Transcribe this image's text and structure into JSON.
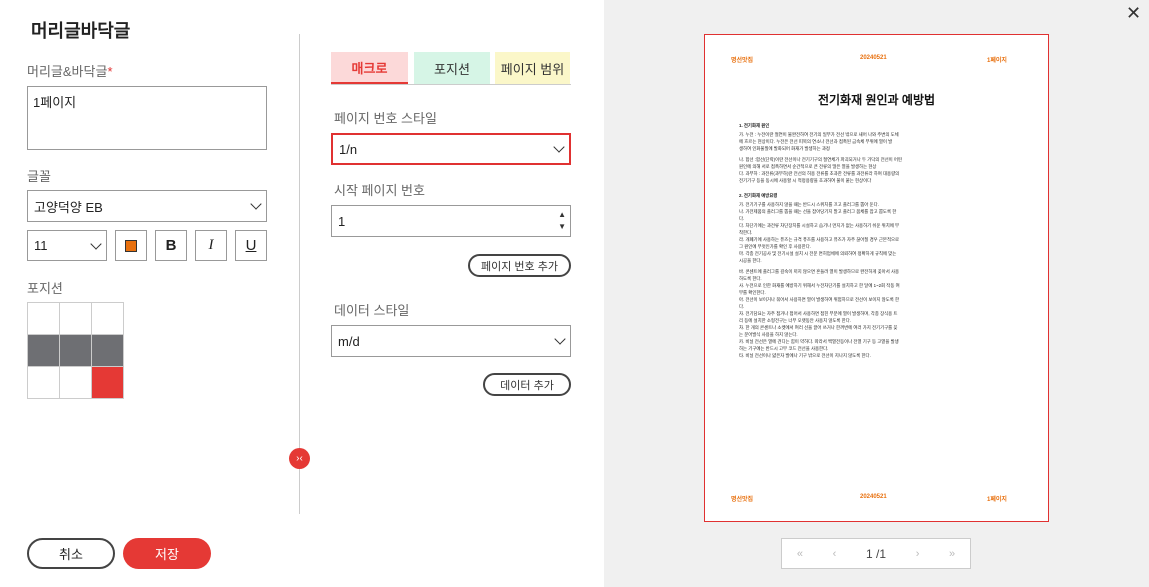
{
  "dialog": {
    "title": "머리글바닥글"
  },
  "left": {
    "header_footer_label": "머리글&바닥글",
    "required_mark": "*",
    "header_footer_value": "1페이지",
    "font_label": "글꼴",
    "font_value": "고양덕양 EB",
    "size_value": "11",
    "text_color": "#e8700e",
    "bold_label": "B",
    "italic_label": "I",
    "underline_label": "U",
    "position_label": "포지션",
    "position_grid": [
      "empty",
      "empty",
      "empty",
      "gray",
      "gray",
      "gray",
      "empty",
      "empty",
      "red"
    ]
  },
  "tabs": [
    {
      "label": "매크로",
      "active": true
    },
    {
      "label": "포지션",
      "active": false
    },
    {
      "label": "페이지 범위",
      "active": false
    }
  ],
  "macro": {
    "page_num_style_label": "페이지 번호 스타일",
    "page_num_style_value": "1/n",
    "start_page_label": "시작 페이지 번호",
    "start_page_value": "1",
    "add_page_num_button": "페이지 번호 추가",
    "data_style_label": "데이터 스타일",
    "data_style_value": "m/d",
    "add_data_button": "데이터 추가"
  },
  "footer": {
    "cancel": "취소",
    "save": "저장"
  },
  "toggle_icon": "›‹",
  "preview": {
    "header_left": "명선맛집",
    "header_center": "20240521",
    "header_right": "1페이지",
    "footer_left": "명선맛집",
    "footer_center": "20240521",
    "footer_right": "1페이지",
    "doc_title": "전기화재 원인과 예방법",
    "section1": "1. 전기화재 원인",
    "s1_lines": [
      "가. 누전 : 누전이란 절연이 불완전하여 전기의 일부가 전선 밖으로 새어 나와 주변의 도체",
      "에 흐르는 현상이다. 누전은 전선 피복의 연소나 전선과 접촉된 금속체 부위에 열이 발",
      "생하여 인화물질에 발화되어 화재가 발생하는 과정"
    ],
    "s1_lines_b": [
      "나. 합선 :합선(단락)이란 전선이나 전기기구의 절연체가 파괴되거나 두 가닥의 전선이 어떤",
      "원인에 의해 서로 접촉하면서 순간적으로 큰 전류의 많은 열을 발생하는 현상",
      "다. 과부하 : 과전류(과부하)란 전선의 허용 전류를 초과한 전류를 과전류라 하며 대용량의",
      "전기기구 등을 동시에 사용할 시 적정용량을 초과하여 불이 붙는 현상이다"
    ],
    "section2": "2. 전기화재 예방요령",
    "s2_lines": [
      "가. 전기기구를 사용하지 않을 때는 반드시 스위치를 끄고 플러그를 뽑아 둔다.",
      "나. 가전제품의 플러그를 뽑을 때는 선을 잡아당기지 말고 플러그 몸체를 잡고 뽑도록 한",
      "다.",
      "다. 차단기에는 과전류 차단장치를 시설하고 습기나 먼지가 없는 사용하기 쉬운 위치에 부",
      "착한다.",
      "라. 개폐기에 사용하는 퓨즈는 규격 퓨즈를 사용하고 퓨즈가 자주 끊어질 경우 근본적으로",
      "그 원인에 무엇인가를 확인 후 사용한다.",
      "마. 각종 전기공사 및 전기시설 설치 시 전문 면허업체에 의뢰하여 정확하게 규칙에 맞는",
      "시공을 한다."
    ],
    "s2_lines_b": [
      "바. 콘센트에 플러그를 깊숙이 끼지 않으면 흔들려 열이 발생하므로 완전하게 꽂아서 사용",
      "하도록 한다.",
      "사. 누전으로 인한 화재를 예방하기 위해서 누전차단기를 설치하고 한 달에 1~2회 작동 여",
      "부를 확인한다.",
      "아. 전선이 보이거나 묶어서 사용하면 열이 발생하여 위험하므로 전선이 보이지 않도록 한",
      "다.",
      "자. 전기담요는 자주 접거나 접어서 사용하면 접힌 부분에 열이 발생하며, 각종 장식용 트",
      "리 등에 설치한 소형전구는 너무 오랫동안 사용치 않도록 한다.",
      "차. 한 개의 콘센트나 소켓에서 여러 선을 끌어 쓰거나 한꺼번에 여러 가지 전기기구를 꽂",
      "는 문어발식 사용을 하지 않는다.",
      "카. 비닐 전선은 열에 견디는 힘이 약하다. 따라서 백열전등이나 전열 기구 등 고열을 발생",
      "하는 기구에는 반드시 고무 코드 전선을 사용한다.",
      "타. 비닐 전선이나 얇은자 발에나 기구 밖으로 전선이 지나지 않도록 한다."
    ]
  },
  "pager": {
    "first_icon": "«",
    "prev_icon": "‹",
    "page_current": "1",
    "page_sep": " /",
    "page_total": "1",
    "next_icon": "›",
    "last_icon": "»"
  },
  "close_icon": "✕"
}
